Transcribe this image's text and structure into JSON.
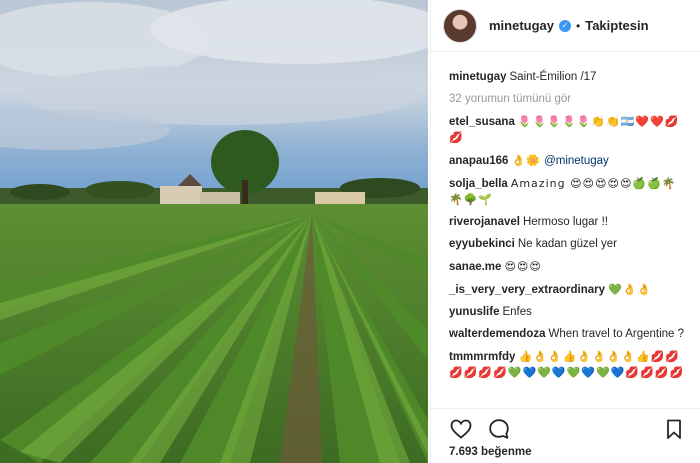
{
  "post": {
    "image_alt": "Saint-Émilion vineyard",
    "likes_text": "7.693 beğenme"
  },
  "header": {
    "username": "minetugay",
    "follow_label": "Takiptesin",
    "separator": "•"
  },
  "caption": {
    "username": "minetugay",
    "text": "Saint-Émilion /17"
  },
  "view_all_comments": "32 yorumun tümünü gör",
  "comments": [
    {
      "username": "etel_susana",
      "text": "🌷🌷🌷🌷🌷👏👏🇦🇷❤️❤️💋💋"
    },
    {
      "username": "anapau166",
      "emoji": "👌🌼",
      "mention": "@minetugay"
    },
    {
      "username": "solja_bella",
      "text": "Amazing 😍😍😍😍😍🍏🍏🌴🌴🌳🌱"
    },
    {
      "username": "riverojanavel",
      "text": "Hermoso lugar !!"
    },
    {
      "username": "eyyubekinci",
      "text": "Ne kadan güzel yer"
    },
    {
      "username": "sanae.me",
      "text": "😍😍😍"
    },
    {
      "username": "_is_very_very_extraordinary",
      "text": "💚👌👌"
    },
    {
      "username": "yunuslife",
      "text": "Enfes"
    },
    {
      "username": "walterdemendoza",
      "text": "When travel to Argentine ?"
    },
    {
      "username": "tmmmrmfdy",
      "text": "👍👌👌👍👌👌👌👌👍💋💋💋💋💋💋💚💙💚💙💚💙💚💙💋💋💋💋"
    }
  ],
  "actions": {
    "like_icon": "heart-icon",
    "comment_icon": "comment-icon",
    "save_icon": "bookmark-icon"
  },
  "colors": {
    "verified": "#3897f0",
    "border": "#efefef",
    "muted": "#999999"
  }
}
